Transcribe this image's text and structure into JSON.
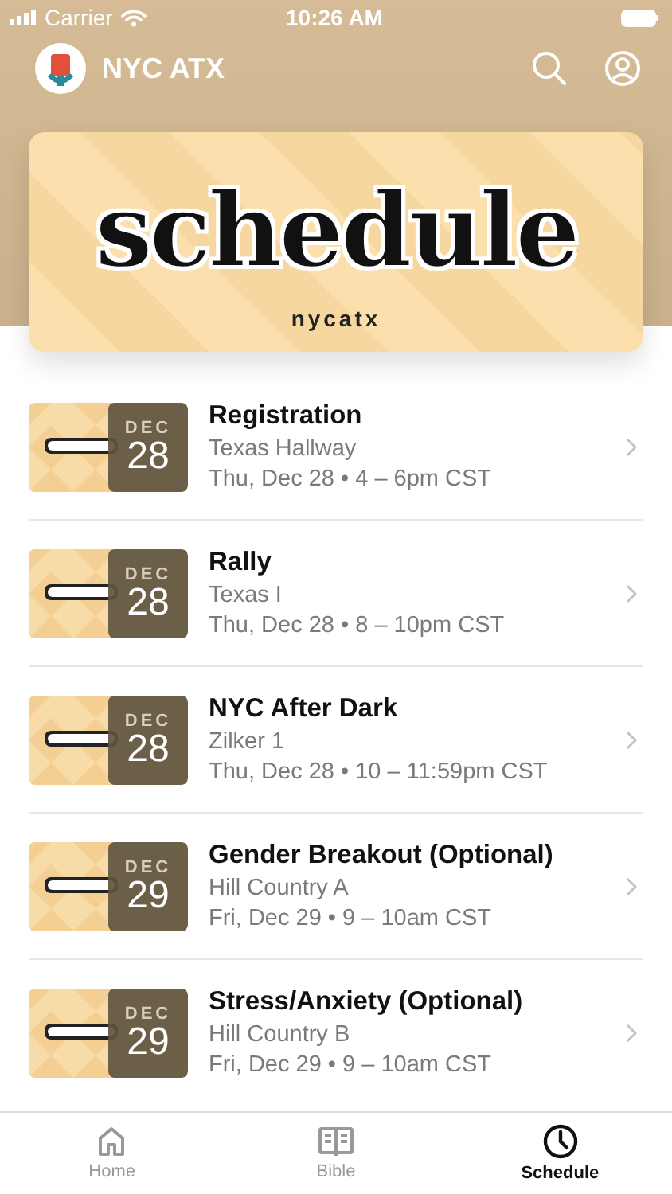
{
  "status_bar": {
    "carrier": "Carrier",
    "time": "10:26 AM"
  },
  "header": {
    "title": "NYC ATX"
  },
  "banner": {
    "title": "schedule",
    "subtitle": "nycatx"
  },
  "events": [
    {
      "month": "DEC",
      "day": "28",
      "title": "Registration",
      "location": "Texas Hallway",
      "time": "Thu, Dec 28 • 4 – 6pm CST"
    },
    {
      "month": "DEC",
      "day": "28",
      "title": "Rally",
      "location": "Texas I",
      "time": "Thu, Dec 28 • 8 – 10pm CST"
    },
    {
      "month": "DEC",
      "day": "28",
      "title": "NYC After Dark",
      "location": "Zilker 1",
      "time": "Thu, Dec 28 • 10 – 11:59pm CST"
    },
    {
      "month": "DEC",
      "day": "29",
      "title": "Gender Breakout (Optional)",
      "location": "Hill Country A",
      "time": "Fri, Dec 29 • 9 – 10am CST"
    },
    {
      "month": "DEC",
      "day": "29",
      "title": "Stress/Anxiety (Optional)",
      "location": "Hill Country B",
      "time": "Fri, Dec 29 • 9 – 10am CST"
    }
  ],
  "tabs": [
    {
      "label": "Home",
      "kind": "home",
      "selected": false
    },
    {
      "label": "Bible",
      "kind": "book",
      "selected": false
    },
    {
      "label": "Schedule",
      "kind": "clock",
      "selected": true
    }
  ]
}
